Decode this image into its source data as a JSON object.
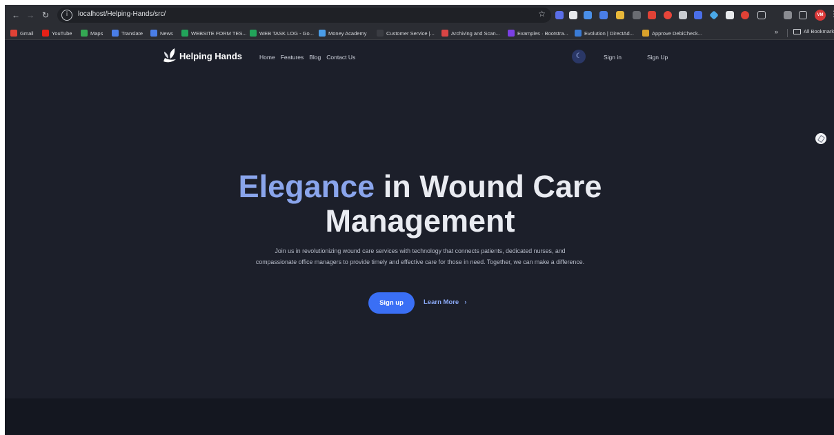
{
  "browser": {
    "url": "localhost/Helping-Hands/src/",
    "bookmarks": [
      {
        "label": "Gmail",
        "color": "#e04236"
      },
      {
        "label": "YouTube",
        "color": "#e62117"
      },
      {
        "label": "Maps",
        "color": "#34a853"
      },
      {
        "label": "Translate",
        "color": "#4a7ee8"
      },
      {
        "label": "News",
        "color": "#4a7ee8"
      },
      {
        "label": "WEBSITE FORM TES...",
        "color": "#22a45a"
      },
      {
        "label": "WEB TASK LOG - Go...",
        "color": "#22a45a"
      },
      {
        "label": "Money Academy",
        "color": "#4a9de8"
      },
      {
        "label": "Customer Service |...",
        "color": "#3a3c42"
      },
      {
        "label": "Archiving and Scan...",
        "color": "#d94545"
      },
      {
        "label": "Examples · Bootstra...",
        "color": "#7a3fe4"
      },
      {
        "label": "Evolution | DirectAd...",
        "color": "#3a7bd5"
      },
      {
        "label": "Approve DebiCheck...",
        "color": "#d9a12b"
      }
    ],
    "more_label": "»",
    "all_bookmarks_label": "All Bookmarks",
    "profile_initials": "VM"
  },
  "site": {
    "brand": "Helping Hands",
    "nav": [
      "Home",
      "Features",
      "Blog",
      "Contact Us"
    ],
    "signin_label": "Sign in",
    "signup_label": "Sign Up",
    "headline_accent": "Elegance",
    "headline_rest": "in Wound Care",
    "headline_line2": "Management",
    "description": "Join us in revolutionizing wound care services with technology that connects patients, dedicated nurses, and compassionate office managers to provide timely and effective care for those in need. Together, we can make a difference.",
    "cta_label": "Sign up",
    "learn_more_label": "Learn More",
    "learn_more_chevron": "›"
  },
  "colors": {
    "page_bg": "#1c1f2a",
    "accent_blue": "#8aa5ec",
    "cta_blue": "#3a6ff5"
  }
}
